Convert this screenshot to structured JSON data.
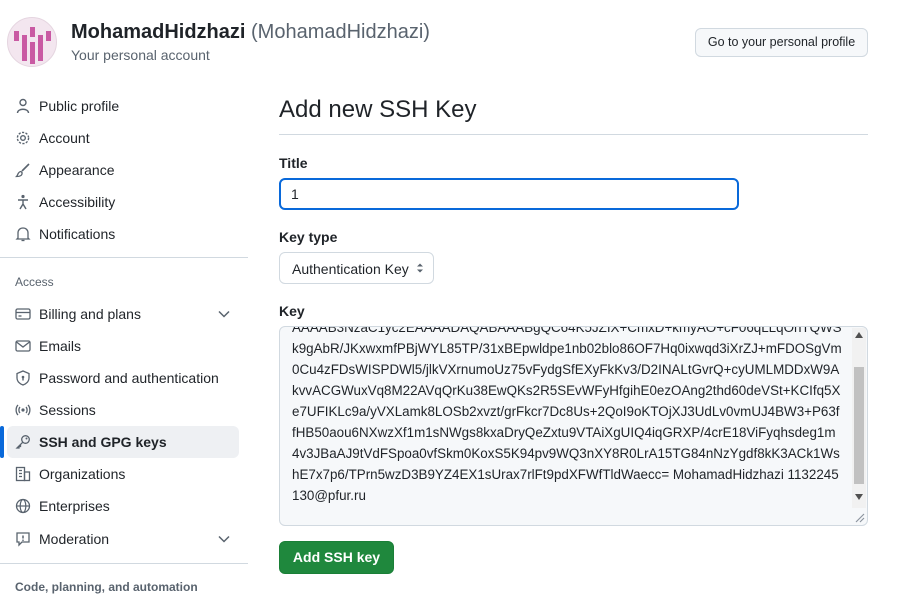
{
  "header": {
    "display_name": "MohamadHidzhazi",
    "login": "(MohamadHidzhazi)",
    "subtitle": "Your personal account",
    "profile_button": "Go to your personal profile"
  },
  "sidebar": {
    "items": [
      {
        "label": "Public profile",
        "icon": "person-icon"
      },
      {
        "label": "Account",
        "icon": "gear-icon"
      },
      {
        "label": "Appearance",
        "icon": "paintbrush-icon"
      },
      {
        "label": "Accessibility",
        "icon": "accessibility-icon"
      },
      {
        "label": "Notifications",
        "icon": "bell-icon"
      }
    ],
    "access_title": "Access",
    "access_items": [
      {
        "label": "Billing and plans",
        "icon": "credit-card-icon"
      },
      {
        "label": "Emails",
        "icon": "mail-icon"
      },
      {
        "label": "Password and authentication",
        "icon": "shield-lock-icon"
      },
      {
        "label": "Sessions",
        "icon": "broadcast-icon"
      },
      {
        "label": "SSH and GPG keys",
        "icon": "key-icon"
      },
      {
        "label": "Organizations",
        "icon": "organization-icon"
      },
      {
        "label": "Enterprises",
        "icon": "globe-icon"
      },
      {
        "label": "Moderation",
        "icon": "report-icon"
      }
    ],
    "code_title": "Code, planning, and automation"
  },
  "main": {
    "title": "Add new SSH Key",
    "title_label": "Title",
    "title_value": "1",
    "key_type_label": "Key type",
    "key_type_value": "Authentication Key",
    "key_label": "Key",
    "key_value": "AAAAB3NzaC1yc2EAAAADAQABAAABgQC64K5JZIX+CmxD+kmyAO+cF06qLLqOnTQWSk9gAbR/JKxwxmfPBjWYL85TP/31xBEpwldpe1nb02blo86OF7Hq0ixwqd3iXrZJ+mFDOSgVm0Cu4zFDsWISPDWl5/jlkVXrnumoUz75vFydgSfEXyFkKv3/D2INALtGvrQ+cyUMLMDDxW9AkvvACGWuxVq8M22AVqQrKu38EwQKs2R5SEvWFyHfgihE0ezOAng2thd60deVSt+KCIfq5Xe7UFIKLc9a/yVXLamk8LOSb2xvzt/grFkcr7Dc8Us+2QoI9oKTOjXJ3UdLv0vmUJ4BW3+P63ffHB50aou6NXwzXf1m1sNWgs8kxaDryQeZxtu9VTAiXgUIQ4iqGRXP/4crE18ViFyqhsdeg1m4v3JBaAJ9tVdFSpoa0vfSkm0KoxS5K94pv9WQ3nXY8R0LrA15TG84nNzYgdf8kK3ACk1WshE7x7p6/TPrn5wzD3B9YZ4EX1sUrax7rlFt9pdXFWfTldWaecc= MohamadHidzhazi 1132245130@pfur.ru",
    "submit_label": "Add SSH key"
  },
  "colors": {
    "accent": "#0969da",
    "primary_button": "#1f883d",
    "avatar": "#c95aa3"
  }
}
